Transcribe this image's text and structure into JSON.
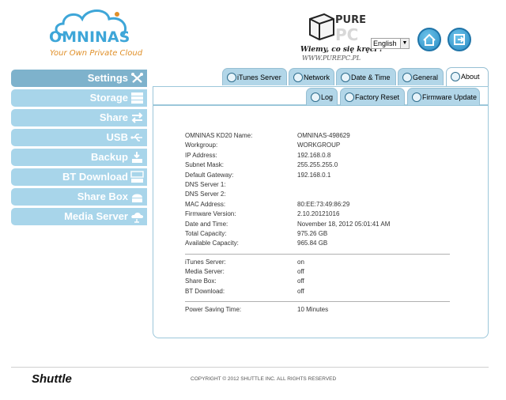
{
  "header": {
    "brand": "OMNINAS",
    "tagline": "Your Own Private Cloud",
    "watermark_top": "PURE",
    "watermark_bottom": "PC",
    "watermark_slogan": "Wiemy, co się kręci !",
    "watermark_url": "WWW.PUREPC.PL",
    "language": "English",
    "home_icon": "home-icon",
    "logout_icon": "logout-icon"
  },
  "sidebar": {
    "items": [
      {
        "label": "Settings",
        "icon": "tools-icon"
      },
      {
        "label": "Storage",
        "icon": "storage-icon"
      },
      {
        "label": "Share",
        "icon": "share-arrows-icon"
      },
      {
        "label": "USB",
        "icon": "usb-icon"
      },
      {
        "label": "Backup",
        "icon": "backup-icon"
      },
      {
        "label": "BT Download",
        "icon": "bt-download-icon"
      },
      {
        "label": "Share Box",
        "icon": "share-box-icon"
      },
      {
        "label": "Media Server",
        "icon": "media-server-icon"
      }
    ]
  },
  "tabs": {
    "main": [
      "iTunes Server",
      "Network",
      "Date & Time",
      "General",
      "About"
    ],
    "sub": [
      "Log",
      "Factory Reset",
      "Firmware Update"
    ]
  },
  "about": {
    "name_label": "OMNINAS KD20 Name:",
    "name_value": "OMNINAS-498629",
    "workgroup_label": "Workgroup:",
    "workgroup_value": "WORKGROUP",
    "ip_label": "IP Address:",
    "ip_value": "192.168.0.8",
    "mask_label": "Subnet Mask:",
    "mask_value": "255.255.255.0",
    "gateway_label": "Default Gateway:",
    "gateway_value": "192.168.0.1",
    "dns1_label": "DNS Server 1:",
    "dns1_value": "",
    "dns2_label": "DNS Server 2:",
    "dns2_value": "",
    "mac_label": "MAC Address:",
    "mac_value": "80:EE:73:49:86:29",
    "firmware_label": "Firmware Version:",
    "firmware_value": "2.10.20121016",
    "datetime_label": "Date and Time:",
    "datetime_value": "November 18, 2012 05:01:41 AM",
    "total_label": "Total Capacity:",
    "total_value": "975.26 GB",
    "avail_label": "Available Capacity:",
    "avail_value": "965.84 GB",
    "itunes_label": "iTunes Server:",
    "itunes_value": "on",
    "media_label": "Media Server:",
    "media_value": "off",
    "sharebox_label": "Share Box:",
    "sharebox_value": "off",
    "bt_label": "BT Download:",
    "bt_value": "off",
    "power_label": "Power Saving Time:",
    "power_value": "10 Minutes"
  },
  "footer": {
    "brand": "Shuttle",
    "copyright": "COPYRIGHT © 2012 SHUTTLE INC. ALL RIGHTS RESERVED"
  },
  "colors": {
    "sidebar_active": "#7eb2cc",
    "sidebar_item": "#a8d5ea",
    "tab_bg": "#b2d6e8",
    "panel_border": "#9cc7da",
    "brand_blue": "#3ea6d8",
    "tagline_orange": "#e0902a"
  }
}
